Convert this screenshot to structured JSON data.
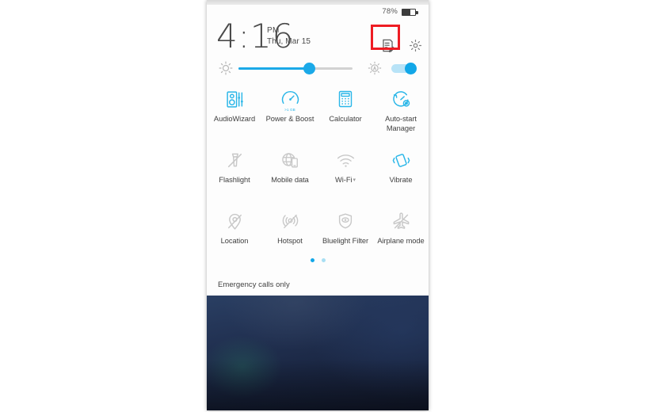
{
  "statusbar": {
    "battery_percent": "78%",
    "battery_icon": "battery-icon"
  },
  "header": {
    "time": "4:16",
    "ampm": "PM",
    "date": "Thu, Mar 15",
    "notes_icon": "notes-edit-icon",
    "settings_icon": "gear-icon"
  },
  "brightness": {
    "brightness_icon": "brightness-sun-icon",
    "auto_brightness_icon": "auto-brightness-icon",
    "slider_value": 62,
    "auto_toggle_on": true
  },
  "tiles": [
    [
      {
        "label": "AudioWizard",
        "icon": "audiowizard-icon",
        "active": true
      },
      {
        "label": "Power & Boost",
        "icon": "power-boost-icon",
        "active": true,
        "badge": ">1 GB"
      },
      {
        "label": "Calculator",
        "icon": "calculator-icon",
        "active": true
      },
      {
        "label": "Auto-start Manager",
        "icon": "auto-start-manager-icon",
        "active": true
      }
    ],
    [
      {
        "label": "Flashlight",
        "icon": "flashlight-icon",
        "active": false
      },
      {
        "label": "Mobile data",
        "icon": "mobile-data-icon",
        "active": false
      },
      {
        "label": "Wi-Fi",
        "icon": "wifi-icon",
        "active": false,
        "caret": true
      },
      {
        "label": "Vibrate",
        "icon": "vibrate-icon",
        "active": true
      }
    ],
    [
      {
        "label": "Location",
        "icon": "location-icon",
        "active": false
      },
      {
        "label": "Hotspot",
        "icon": "hotspot-icon",
        "active": false
      },
      {
        "label": "Bluelight Filter",
        "icon": "bluelight-filter-icon",
        "active": false
      },
      {
        "label": "Airplane mode",
        "icon": "airplane-mode-icon",
        "active": false
      }
    ]
  ],
  "pager": {
    "total": 2,
    "current": 1
  },
  "footer": {
    "carrier_status": "Emergency calls only"
  },
  "colors": {
    "accent": "#12a7e8",
    "inactive": "#c4c4c4",
    "highlight": "#ee1c23",
    "text": "#3f3f3f"
  }
}
